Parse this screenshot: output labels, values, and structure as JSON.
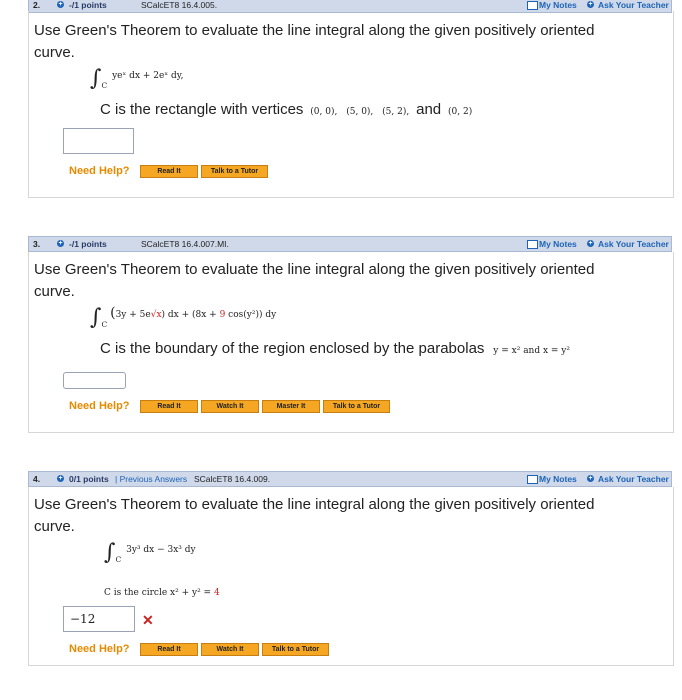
{
  "q2": {
    "number": "2.",
    "points": "-/1 points",
    "source": "SCalcET8 16.4.005.",
    "my_notes": "My Notes",
    "ask_teacher": "Ask Your Teacher",
    "prompt": "Use Green's Theorem to evaluate the line integral along the given positively oriented curve.",
    "integral_sub": "C",
    "integrand": "yeˣ dx + 2eˣ dy,",
    "curve_text": "C is the rectangle with vertices",
    "v1": "(0, 0),",
    "v2": "(5, 0),",
    "v3": "(5, 2),",
    "and": "and",
    "v4": "(0, 2)",
    "answer": "",
    "need_help": "Need Help?",
    "buttons": [
      "Read It",
      "Talk to a Tutor"
    ]
  },
  "q3": {
    "number": "3.",
    "points": "-/1 points",
    "source": "SCalcET8 16.4.007.MI.",
    "my_notes": "My Notes",
    "ask_teacher": "Ask Your Teacher",
    "prompt": "Use Green's Theorem to evaluate the line integral along the given positively oriented curve.",
    "integral_sub": "C",
    "part1": "3y + 5e",
    "part1_red": "√x",
    "mid": ") dx + (",
    "part2a": "8x + ",
    "part2b": "9",
    "part2c": " cos(y²)",
    "tail": ") dy",
    "curve_text": "C is the boundary of the region enclosed by the parabolas",
    "parabolas": "y = x² and x = y²",
    "answer": "",
    "need_help": "Need Help?",
    "buttons": [
      "Read It",
      "Watch It",
      "Master It",
      "Talk to a Tutor"
    ]
  },
  "q4": {
    "number": "4.",
    "points": "0/1 points",
    "prev_answers": "| Previous Answers",
    "source": "SCalcET8 16.4.009.",
    "my_notes": "My Notes",
    "ask_teacher": "Ask Your Teacher",
    "prompt": "Use Green's Theorem to evaluate the line integral along the given positively oriented curve.",
    "integral_sub": "C",
    "integrand": "3y³ dx − 3x³ dy",
    "curve_text": "C is the circle x² + y² = ",
    "radius_sq": "4",
    "answer": "−12",
    "need_help": "Need Help?",
    "buttons": [
      "Read It",
      "Watch It",
      "Talk to a Tutor"
    ]
  }
}
